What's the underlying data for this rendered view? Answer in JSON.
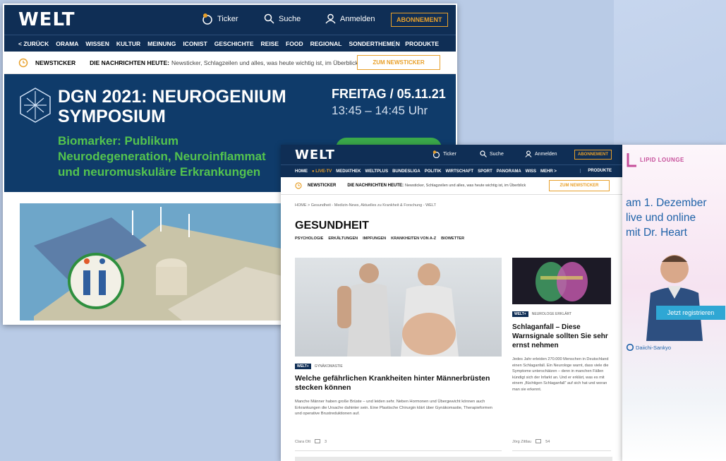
{
  "back_screen": {
    "logo": "WELT",
    "ticker_label": "Ticker",
    "search_label": "Suche",
    "login_label": "Anmelden",
    "abo_label": "ABONNEMENT",
    "nav": [
      "< ZURÜCK",
      "ORAMA",
      "WISSEN",
      "KULTUR",
      "MEINUNG",
      "ICONIST",
      "GESCHICHTE",
      "REISE",
      "FOOD",
      "REGIONAL",
      "SONDERTHEMEN"
    ],
    "nav_right": "PRODUKTE",
    "newsticker_label": "NEWSTICKER",
    "newsticker_heading": "DIE NACHRICHTEN HEUTE:",
    "newsticker_text": "Newsticker, Schlagzeilen und alles, was heute wichtig ist, im Überblick",
    "newsticker_button": "ZUM NEWSTICKER",
    "event_title_1": "DGN 2021: NEUROGENIUM",
    "event_title_2": "SYMPOSIUM",
    "event_date": "FREITAG / 05.11.21",
    "event_time": "13:45 – 14:45 Uhr",
    "event_sub_1": "Biomarker: Publikum",
    "event_sub_2": "Neurodegeneration, Neuroinflammat",
    "event_sub_3": "und neuromuskuläre Erkrankungen"
  },
  "front_screen": {
    "logo": "WELT",
    "ticker_label": "Ticker",
    "search_label": "Suche",
    "login_label": "Anmelden",
    "abo_label": "ABONNEMENT",
    "nav": [
      "HOME",
      "● LIVE-TV",
      "MEDIATHEK",
      "WELTPLUS",
      "BUNDESLIGA",
      "POLITIK",
      "WIRTSCHAFT",
      "SPORT",
      "PANORAMA",
      "WISS",
      "MEHR >"
    ],
    "nav_right": "PRODUKTE",
    "newsticker_label": "NEWSTICKER",
    "newsticker_heading": "DIE NACHRICHTEN HEUTE:",
    "newsticker_text": "Newsticker, Schlagzeilen und alles, was heute wichtig ist, im Überblick",
    "newsticker_button": "ZUM NEWSTICKER",
    "breadcrumb": "HOME > Gesundheit - Medizin-News, Aktuelles zu Krankheit & Forschung - WELT",
    "section_title": "GESUNDHEIT",
    "subnav": [
      "PSYCHOLOGIE",
      "ERKÄLTUNGEN",
      "IMPFUNGEN",
      "KRANKHEITEN VON A-Z",
      "BIOWETTER"
    ],
    "article1": {
      "badge": "WELT+",
      "kicker": "GYNÄKOMASTIE",
      "title": "Welche gefährlichen Krankheiten hinter Männerbrüsten stecken können",
      "teaser": "Manche Männer haben große Brüste – und leiden sehr. Neben Hormonen und Übergewicht können auch Erkrankungen die Ursache dahinter sein. Eine Plastische Chirurgin klärt über Gynäkomastie, Therapieformen und operative Brustreduktionen auf.",
      "author": "Clara Ott",
      "comments": "3"
    },
    "article2": {
      "badge": "WELT+",
      "kicker": "NEUROLOGE ERKLÄRT",
      "title": "Schlaganfall – Diese Warnsignale sollten Sie sehr ernst nehmen",
      "teaser": "Jedes Jahr erleiden 270.000 Menschen in Deutschland einen Schlaganfall. Ein Neurologe warnt, dass viele die Symptome unterschätzen – denn in manchen Fällen kündigt sich der Infarkt an. Und er erklärt, was es mit einem „flüchtigen Schlaganfall“ auf sich hat und woran man sie erkennt.",
      "author": "Jörg Zittlau",
      "comments": "54"
    }
  },
  "ad": {
    "brand": "LIPID LOUNGE",
    "line1": "am 1. Dezember",
    "line2": "live und online",
    "line3": "mit Dr. Heart",
    "cta": "Jetzt registrieren",
    "sponsor": "Daiichi-Sankyo"
  }
}
